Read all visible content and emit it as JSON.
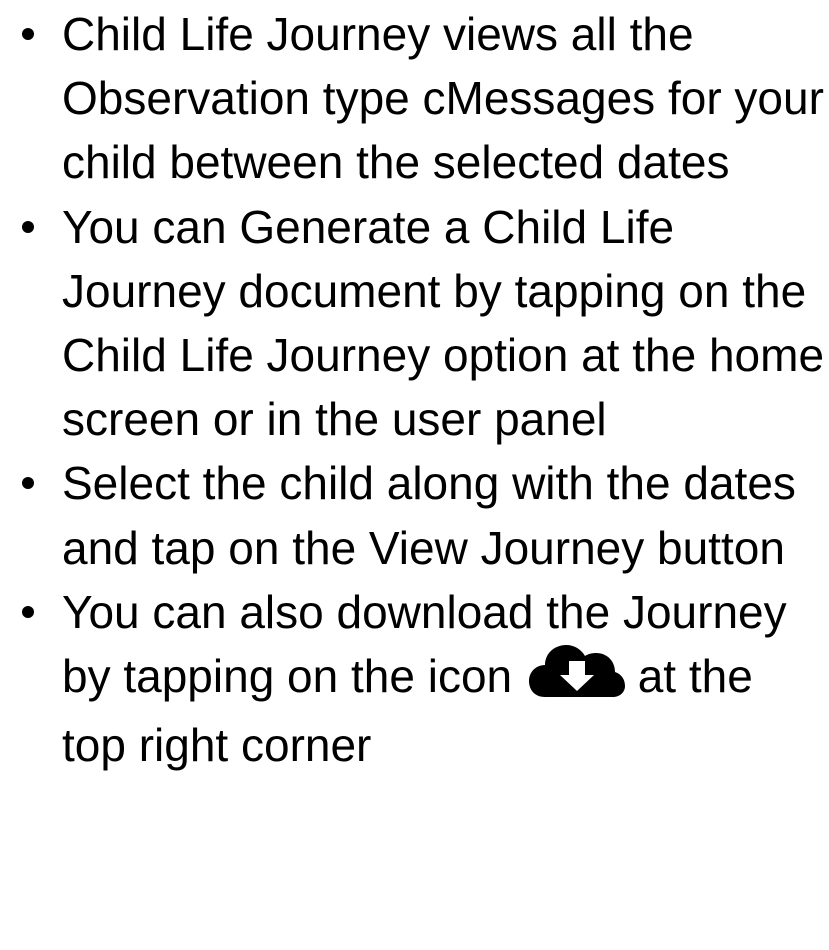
{
  "items": [
    {
      "text": "Child Life Journey views all the Observation type cMessages for your child between the selected dates"
    },
    {
      "text": "You can Generate a Child Life Journey document by tapping on the Child Life Journey option at the home screen or in the user panel"
    },
    {
      "text": "Select the child along with the dates and tap on the View Journey button"
    },
    {
      "text_before_icon": "You can also download the Journey by tapping on the icon",
      "icon": "cloud-download-icon",
      "text_after_icon": "at the top right corner"
    }
  ],
  "colors": {
    "text": "#000000",
    "bullet": "#000000",
    "icon": "#000000",
    "background": "#ffffff"
  }
}
